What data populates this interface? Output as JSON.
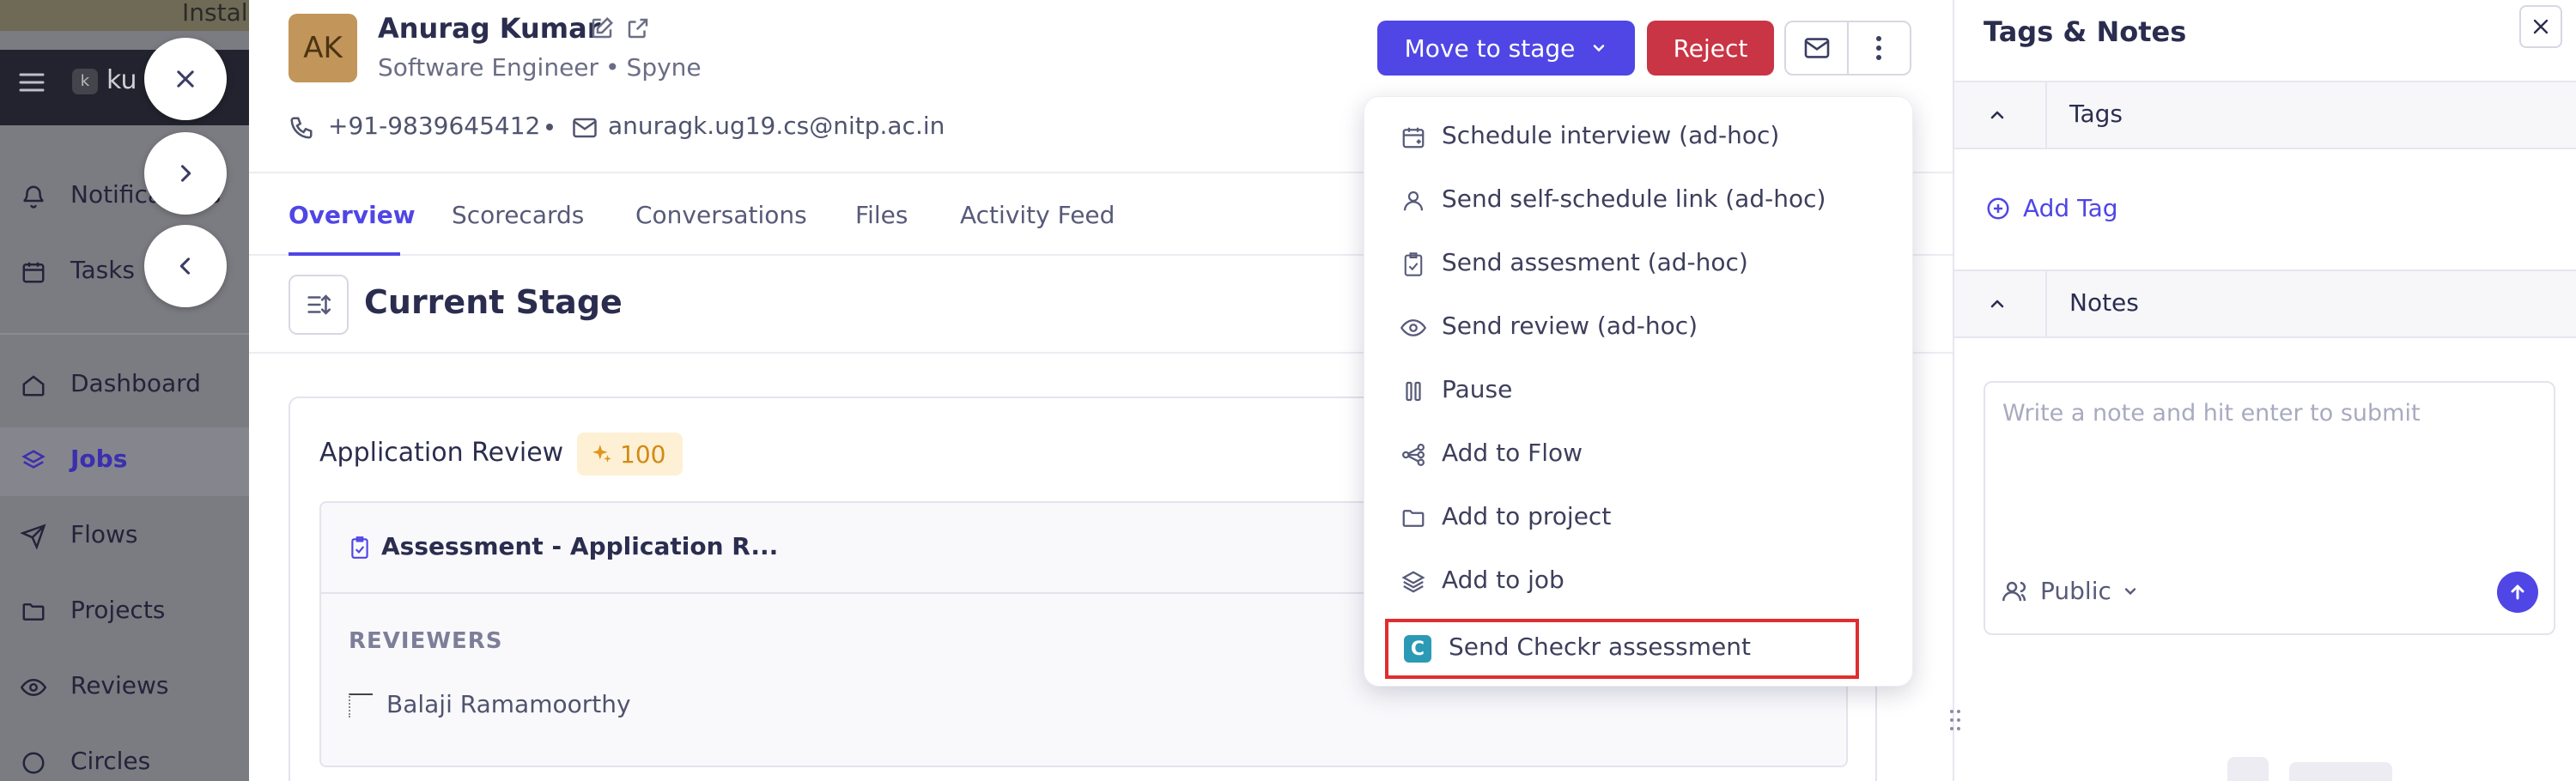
{
  "background": {
    "install_text": "Install",
    "logo_text": "ku",
    "nav": {
      "notifications": "Notifications",
      "tasks": "Tasks",
      "dashboard": "Dashboard",
      "jobs": "Jobs",
      "flows": "Flows",
      "projects": "Projects",
      "reviews": "Reviews",
      "circles": "Circles"
    }
  },
  "candidate": {
    "initials": "AK",
    "name": "Anurag Kumar",
    "role": "Software Engineer",
    "company": "Spyne",
    "phone": "+91-9839645412",
    "email": "anuragk.ug19.cs@nitp.ac.in"
  },
  "header": {
    "move_to_stage": "Move to stage",
    "reject": "Reject"
  },
  "tabs": [
    "Overview",
    "Scorecards",
    "Conversations",
    "Files",
    "Activity Feed"
  ],
  "stage": {
    "title": "Current Stage",
    "review_title": "Application Review",
    "score": "100",
    "assessment_title": "Assessment - Application R...",
    "reviewers_label": "REVIEWERS",
    "reviewer_name": "Balaji Ramamoorthy"
  },
  "dropdown": {
    "items": [
      {
        "label": "Schedule interview (ad-hoc)",
        "icon": "calendar-plus-icon"
      },
      {
        "label": "Send self-schedule link (ad-hoc)",
        "icon": "user-icon"
      },
      {
        "label": "Send assesment (ad-hoc)",
        "icon": "clipboard-check-icon"
      },
      {
        "label": "Send review (ad-hoc)",
        "icon": "eye-icon"
      },
      {
        "label": "Pause",
        "icon": "pause-icon"
      },
      {
        "label": "Add to Flow",
        "icon": "flow-icon"
      },
      {
        "label": "Add to project",
        "icon": "folder-icon"
      },
      {
        "label": "Add to job",
        "icon": "layers-icon"
      },
      {
        "label": "Send Checkr assessment",
        "icon": "checkr-logo"
      }
    ],
    "checkr_letter": "C"
  },
  "right_panel": {
    "title": "Tags & Notes",
    "tags_label": "Tags",
    "add_tag": "Add Tag",
    "notes_label": "Notes",
    "note_placeholder": "Write a note and hit enter to submit",
    "visibility": "Public"
  },
  "colors": {
    "primary": "#4f46e5",
    "reject": "#c93545",
    "highlight": "#e12d2d",
    "checkr": "#2b9ab4"
  }
}
